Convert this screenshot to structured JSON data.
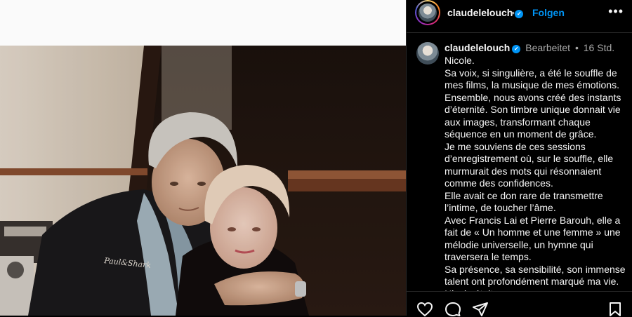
{
  "post": {
    "username": "claudelelouch",
    "follow_label": "Folgen",
    "separator": "•",
    "more_icon": "more-horizontal-icon",
    "edited_label": "Bearbeitet",
    "meta_separator": "•",
    "time_ago": "16 Std."
  },
  "caption": {
    "lines": [
      "Nicole.",
      "Sa voix, si singulière, a été le souffle de mes films, la musique de mes émotions.",
      "Ensemble, nous avons créé des instants d’éternité. Son timbre unique donnait vie aux images, transformant chaque séquence en un moment de grâce.",
      "Je me souviens de ces sessions d’enregistrement où, sur le souffle, elle murmurait des mots qui résonnaient comme des confidences.",
      "Elle avait ce don rare de transmettre l’intime, de toucher l’âme.",
      "Avec Francis Lai et Pierre Barouh, elle a fait de « Un homme et une femme » une mélodie universelle, un hymne qui traversera le temps.",
      "Sa présence, sa sensibilité, son immense talent ont profondément marqué ma vie. Nicole était une muse"
    ]
  },
  "photo": {
    "jacket_logo_text": "Paul&Shark"
  },
  "actions": {
    "icons": [
      "heart-icon",
      "comment-icon",
      "share-icon",
      "bookmark-icon"
    ]
  },
  "colors": {
    "accent": "#0095f6",
    "background": "#000000",
    "muted": "#a8a8a8"
  }
}
